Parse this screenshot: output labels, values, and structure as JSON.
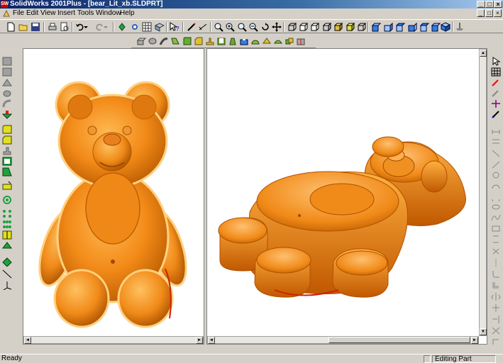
{
  "window": {
    "title": "SolidWorks 2001Plus - [bear_Lit_xb.SLDPRT]",
    "app_icon_text": "SW",
    "controls": [
      "_",
      "□",
      "×"
    ]
  },
  "menu": {
    "items": [
      "File",
      "Edit",
      "View",
      "Insert",
      "Tools",
      "Window",
      "Help"
    ],
    "doc_controls": [
      "_",
      "□",
      "×"
    ]
  },
  "status": {
    "left": "Ready",
    "mode": "Editing Part"
  },
  "colors": {
    "part": "#f08c1a",
    "part_dark": "#a04a00",
    "part_light": "#ffc060"
  }
}
